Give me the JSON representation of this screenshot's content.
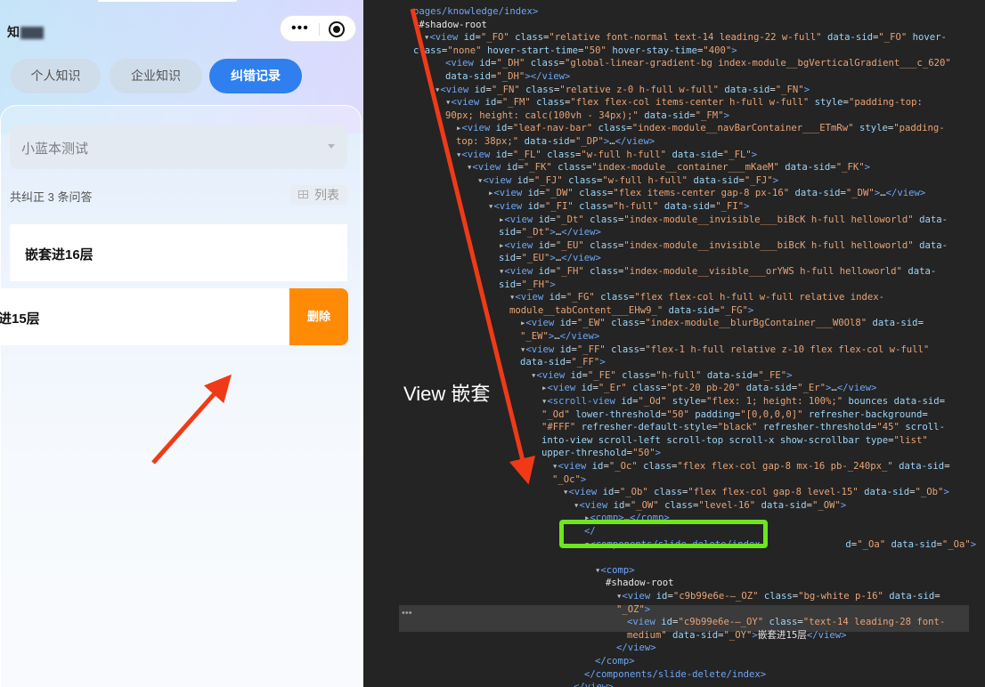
{
  "phone": {
    "app_name": "知",
    "tabs": [
      {
        "label": "个人知识",
        "active": false
      },
      {
        "label": "企业知识",
        "active": false
      },
      {
        "label": "纠错记录",
        "active": true
      }
    ],
    "select_value": "小蓝本测试",
    "count_text": "共纠正 3 条问答",
    "view_toggle": "列表",
    "cards": [
      {
        "title": "嵌套进16层"
      },
      {
        "title": "进15层"
      }
    ],
    "delete_label": "删除"
  },
  "annotation": {
    "label": "View 嵌套",
    "arrow_color": "#f03a17",
    "highlight_color": "#6ee61e"
  },
  "devtools_lines": [
    {
      "indent": 1,
      "tri": "",
      "html": "<span class='t'>pages/knowledge/index&gt;</span>"
    },
    {
      "indent": 1,
      "tri": "▾",
      "html": "<span class='w'>#shadow-root</span>"
    },
    {
      "indent": 2,
      "tri": "▾",
      "html": "<span class='t'>&lt;view</span> <span class='a'>id</span>=<span class='v'>\"_FO\"</span> <span class='a'>class</span>=<span class='v'>\"relative font-normal text-14 leading-22 w-full\"</span> <span class='a'>data-sid</span>=<span class='v'>\"_FO\"</span> <span class='a'>hover-</span>"
    },
    {
      "indent": 1,
      "tri": "",
      "html": "<span class='a'>class</span>=<span class='v'>\"none\"</span> <span class='a'>hover-start-time</span>=<span class='v'>\"50\"</span> <span class='a'>hover-stay-time</span>=<span class='v'>\"400\"</span><span class='t'>&gt;</span>"
    },
    {
      "indent": 4,
      "tri": "",
      "html": "<span class='t'>&lt;view</span> <span class='a'>id</span>=<span class='v'>\"_DH\"</span> <span class='a'>class</span>=<span class='v'>\"global-linear-gradient-bg index-module__bgVerticalGradient___c_620\"</span>"
    },
    {
      "indent": 4,
      "tri": "",
      "html": "<span class='a'>data-sid</span>=<span class='v'>\"_DH\"</span><span class='t'>&gt;&lt;/view&gt;</span>"
    },
    {
      "indent": 3,
      "tri": "▾",
      "html": "<span class='t'>&lt;view</span> <span class='a'>id</span>=<span class='v'>\"_FN\"</span> <span class='a'>class</span>=<span class='v'>\"relative z-0 h-full w-full\"</span> <span class='a'>data-sid</span>=<span class='v'>\"_FN\"</span><span class='t'>&gt;</span>"
    },
    {
      "indent": 4,
      "tri": "▾",
      "html": "<span class='t'>&lt;view</span> <span class='a'>id</span>=<span class='v'>\"_FM\"</span> <span class='a'>class</span>=<span class='v'>\"flex flex-col items-center h-full w-full\"</span> <span class='a'>style</span>=<span class='v'>\"padding-top:</span>"
    },
    {
      "indent": 4,
      "tri": "",
      "html": "<span class='v'>90px; height: calc(100vh - 34px);\"</span> <span class='a'>data-sid</span>=<span class='v'>\"_FM\"</span><span class='t'>&gt;</span>"
    },
    {
      "indent": 5,
      "tri": "▸",
      "html": "<span class='t'>&lt;view</span> <span class='a'>id</span>=<span class='v'>\"leaf-nav-bar\"</span> <span class='a'>class</span>=<span class='v'>\"index-module__navBarContainer___ETmRw\"</span> <span class='a'>style</span>=<span class='v'>\"padding-</span>"
    },
    {
      "indent": 5,
      "tri": "",
      "html": "<span class='v'>top: 38px;\"</span> <span class='a'>data-sid</span>=<span class='v'>\"_DP\"</span><span class='t'>&gt;</span>…<span class='t'>&lt;/view&gt;</span>"
    },
    {
      "indent": 5,
      "tri": "▾",
      "html": "<span class='t'>&lt;view</span> <span class='a'>id</span>=<span class='v'>\"_FL\"</span> <span class='a'>class</span>=<span class='v'>\"w-full h-full\"</span> <span class='a'>data-sid</span>=<span class='v'>\"_FL\"</span><span class='t'>&gt;</span>"
    },
    {
      "indent": 6,
      "tri": "▾",
      "html": "<span class='t'>&lt;view</span> <span class='a'>id</span>=<span class='v'>\"_FK\"</span> <span class='a'>class</span>=<span class='v'>\"index-module__container___mKaeM\"</span> <span class='a'>data-sid</span>=<span class='v'>\"_FK\"</span><span class='t'>&gt;</span>"
    },
    {
      "indent": 7,
      "tri": "▾",
      "html": "<span class='t'>&lt;view</span> <span class='a'>id</span>=<span class='v'>\"_FJ\"</span> <span class='a'>class</span>=<span class='v'>\"w-full h-full\"</span> <span class='a'>data-sid</span>=<span class='v'>\"_FJ\"</span><span class='t'>&gt;</span>"
    },
    {
      "indent": 8,
      "tri": "▸",
      "html": "<span class='t'>&lt;view</span> <span class='a'>id</span>=<span class='v'>\"_DW\"</span> <span class='a'>class</span>=<span class='v'>\"flex items-center gap-8 px-16\"</span> <span class='a'>data-sid</span>=<span class='v'>\"_DW\"</span><span class='t'>&gt;</span>…<span class='t'>&lt;/view&gt;</span>"
    },
    {
      "indent": 8,
      "tri": "▾",
      "html": "<span class='t'>&lt;view</span> <span class='a'>id</span>=<span class='v'>\"_FI\"</span> <span class='a'>class</span>=<span class='v'>\"h-full\"</span> <span class='a'>data-sid</span>=<span class='v'>\"_FI\"</span><span class='t'>&gt;</span>"
    },
    {
      "indent": 9,
      "tri": "▸",
      "html": "<span class='t'>&lt;view</span> <span class='a'>id</span>=<span class='v'>\"_Dt\"</span> <span class='a'>class</span>=<span class='v'>\"index-module__invisible___biBcK h-full helloworld\"</span> <span class='a'>data-</span>"
    },
    {
      "indent": 9,
      "tri": "",
      "html": "<span class='a'>sid</span>=<span class='v'>\"_Dt\"</span><span class='t'>&gt;</span>…<span class='t'>&lt;/view&gt;</span>"
    },
    {
      "indent": 9,
      "tri": "▸",
      "html": "<span class='t'>&lt;view</span> <span class='a'>id</span>=<span class='v'>\"_EU\"</span> <span class='a'>class</span>=<span class='v'>\"index-module__invisible___biBcK h-full helloworld\"</span> <span class='a'>data-</span>"
    },
    {
      "indent": 9,
      "tri": "",
      "html": "<span class='a'>sid</span>=<span class='v'>\"_EU\"</span><span class='t'>&gt;</span>…<span class='t'>&lt;/view&gt;</span>"
    },
    {
      "indent": 9,
      "tri": "▾",
      "html": "<span class='t'>&lt;view</span> <span class='a'>id</span>=<span class='v'>\"_FH\"</span> <span class='a'>class</span>=<span class='v'>\"index-module__visible___orYWS h-full helloworld\"</span> <span class='a'>data-</span>"
    },
    {
      "indent": 9,
      "tri": "",
      "html": "<span class='a'>sid</span>=<span class='v'>\"_FH\"</span><span class='t'>&gt;</span>"
    },
    {
      "indent": 10,
      "tri": "▾",
      "html": "<span class='t'>&lt;view</span> <span class='a'>id</span>=<span class='v'>\"_FG\"</span> <span class='a'>class</span>=<span class='v'>\"flex flex-col h-full w-full relative index-</span>"
    },
    {
      "indent": 10,
      "tri": "",
      "html": "<span class='v'>module__tabContent___EHw9_\"</span> <span class='a'>data-sid</span>=<span class='v'>\"_FG\"</span><span class='t'>&gt;</span>"
    },
    {
      "indent": 11,
      "tri": "▸",
      "html": "<span class='t'>&lt;view</span> <span class='a'>id</span>=<span class='v'>\"_EW\"</span> <span class='a'>class</span>=<span class='v'>\"index-module__blurBgContainer___W0Ol8\"</span> <span class='a'>data-sid</span>="
    },
    {
      "indent": 11,
      "tri": "",
      "html": "<span class='v'>\"_EW\"</span><span class='t'>&gt;</span>…<span class='t'>&lt;/view&gt;</span>"
    },
    {
      "indent": 11,
      "tri": "▾",
      "html": "<span class='t'>&lt;view</span> <span class='a'>id</span>=<span class='v'>\"_FF\"</span> <span class='a'>class</span>=<span class='v'>\"flex-1 h-full relative z-10 flex flex-col w-full\"</span>"
    },
    {
      "indent": 11,
      "tri": "",
      "html": "<span class='a'>data-sid</span>=<span class='v'>\"_FF\"</span><span class='t'>&gt;</span>"
    },
    {
      "indent": 12,
      "tri": "▾",
      "html": "<span class='t'>&lt;view</span> <span class='a'>id</span>=<span class='v'>\"_FE\"</span> <span class='a'>class</span>=<span class='v'>\"h-full\"</span> <span class='a'>data-sid</span>=<span class='v'>\"_FE\"</span><span class='t'>&gt;</span>"
    },
    {
      "indent": 13,
      "tri": "▸",
      "html": "<span class='t'>&lt;view</span> <span class='a'>id</span>=<span class='v'>\"_Er\"</span> <span class='a'>class</span>=<span class='v'>\"pt-20 pb-20\"</span> <span class='a'>data-sid</span>=<span class='v'>\"_Er\"</span><span class='t'>&gt;</span>…<span class='t'>&lt;/view&gt;</span>"
    },
    {
      "indent": 13,
      "tri": "▾",
      "html": "<span class='t'>&lt;scroll-view</span> <span class='a'>id</span>=<span class='v'>\"_Od\"</span> <span class='a'>style</span>=<span class='v'>\"flex: 1; height: 100%;\"</span> <span class='a'>bounces</span> <span class='a'>data-sid</span>="
    },
    {
      "indent": 13,
      "tri": "",
      "html": "<span class='v'>\"_Od\"</span> <span class='a'>lower-threshold</span>=<span class='v'>\"50\"</span> <span class='a'>padding</span>=<span class='v'>\"[0,0,0,0]\"</span> <span class='a'>refresher-background</span>="
    },
    {
      "indent": 13,
      "tri": "",
      "html": "<span class='v'>\"#FFF\"</span> <span class='a'>refresher-default-style</span>=<span class='v'>\"black\"</span> <span class='a'>refresher-threshold</span>=<span class='v'>\"45\"</span> <span class='a'>scroll-</span>"
    },
    {
      "indent": 13,
      "tri": "",
      "html": "<span class='a'>into-view scroll-left scroll-top scroll-x show-scrollbar</span> <span class='a'>type</span>=<span class='v'>\"list\"</span>"
    },
    {
      "indent": 13,
      "tri": "",
      "html": "<span class='a'>upper-threshold</span>=<span class='v'>\"50\"</span><span class='t'>&gt;</span>"
    },
    {
      "indent": 14,
      "tri": "▾",
      "html": "<span class='t'>&lt;view</span> <span class='a'>id</span>=<span class='v'>\"_Oc\"</span> <span class='a'>class</span>=<span class='v'>\"flex flex-col gap-8 mx-16 pb-_240px_\"</span> <span class='a'>data-sid</span>="
    },
    {
      "indent": 14,
      "tri": "",
      "html": "<span class='v'>\"_Oc\"</span><span class='t'>&gt;</span>"
    },
    {
      "indent": 15,
      "tri": "▾",
      "html": "<span class='t'>&lt;view</span> <span class='a'>id</span>=<span class='v'>\"_Ob\"</span> <span class='a'>class</span>=<span class='v'>\"flex flex-col gap-8 level-15\"</span> <span class='a'>data-sid</span>=<span class='v'>\"_Ob\"</span><span class='t'>&gt;</span>"
    },
    {
      "indent": 16,
      "tri": "▾",
      "html": "<span class='t'>&lt;view</span> <span class='a'>id</span>=<span class='v'>\"_OW\"</span> <span class='a'>class</span>=<span class='v'>\"level-16\"</span> <span class='a'>data-sid</span>=<span class='v'>\"_OW\"</span><span class='t'>&gt;</span>"
    },
    {
      "indent": 17,
      "tri": "▸",
      "html": "<span class='t'>&lt;comp&gt;</span>…<span class='t'>&lt;/comp&gt;</span>"
    },
    {
      "indent": 17,
      "tri": "",
      "html": "<span class='t'>&lt;/</span>"
    },
    {
      "indent": 17,
      "tri": "▾",
      "html": "<span class='t'>&lt;components/slide-delete/index</span>               <span class='a'>d</span>=<span class='v'>\"_Oa\"</span> <span class='a'>data-sid</span>=<span class='v'>\"_Oa\"</span><span class='t'>&gt;</span>"
    },
    {
      "indent": 17,
      "tri": "",
      "html": ""
    },
    {
      "indent": 18,
      "tri": "▾",
      "html": "<span class='t'>&lt;comp&gt;</span>"
    },
    {
      "indent": 19,
      "tri": "",
      "html": "<span class='w'>#shadow-root</span>"
    },
    {
      "indent": 20,
      "tri": "▾",
      "html": "<span class='t'>&lt;view</span> <span class='a'>id</span>=<span class='v'>\"c9b99e6e-—_OZ\"</span> <span class='a'>class</span>=<span class='v'>\"bg-white p-16\"</span> <span class='a'>data-sid</span>="
    },
    {
      "indent": 20,
      "tri": "",
      "html": "<span class='v'>\"_OZ\"</span><span class='t'>&gt;</span>"
    },
    {
      "indent": 21,
      "tri": "",
      "html": "<span class='t'>&lt;view</span> <span class='a'>id</span>=<span class='v'>\"c9b99e6e-—_OY\"</span> <span class='a'>class</span>=<span class='v'>\"text-14 leading-28 font-</span>"
    },
    {
      "indent": 21,
      "tri": "",
      "html": "<span class='v'>medium\"</span> <span class='a'>data-sid</span>=<span class='v'>\"_OY\"</span><span class='t'>&gt;</span><span class='w'>嵌套进15层</span><span class='t'>&lt;/view&gt;</span>"
    },
    {
      "indent": 20,
      "tri": "",
      "html": "<span class='t'>&lt;/view&gt;</span>"
    },
    {
      "indent": 18,
      "tri": "",
      "html": "<span class='t'>&lt;/comp&gt;</span>"
    },
    {
      "indent": 17,
      "tri": "",
      "html": "<span class='t'>&lt;/components/slide-delete/index&gt;</span>"
    },
    {
      "indent": 16,
      "tri": "",
      "html": "<span class='t'>&lt;/view&gt;</span>"
    }
  ]
}
